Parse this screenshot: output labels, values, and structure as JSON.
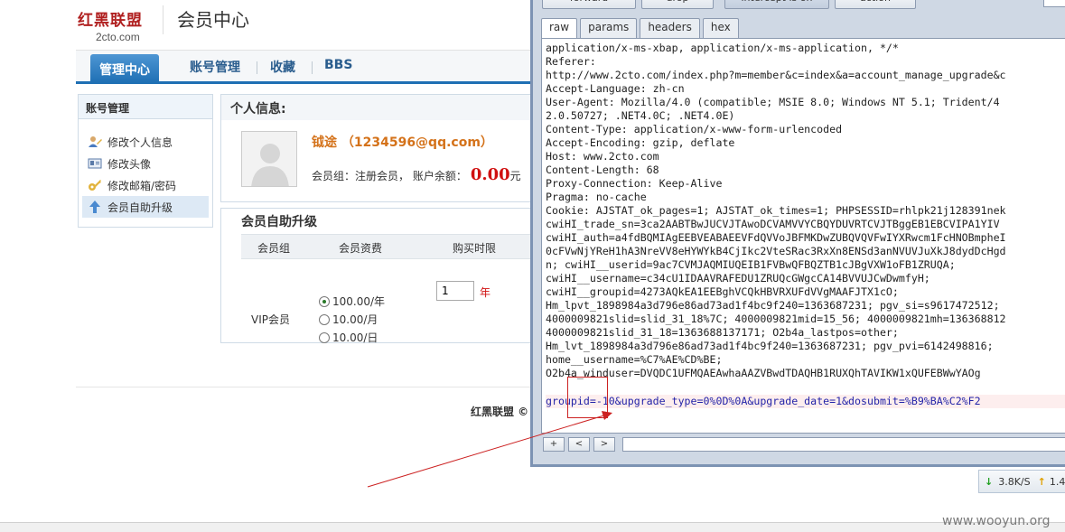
{
  "site": {
    "logo_mark": "红黑联盟",
    "logo_domain": "2cto.com",
    "page_title": "会员中心"
  },
  "nav": {
    "items": [
      {
        "label": "管理中心"
      },
      {
        "label": "账号管理"
      },
      {
        "label": "收藏"
      },
      {
        "label": "BBS"
      }
    ]
  },
  "sidebar": {
    "title": "账号管理",
    "items": [
      {
        "label": "修改个人信息",
        "icon": "user-edit-icon"
      },
      {
        "label": "修改头像",
        "icon": "avatar-card-icon"
      },
      {
        "label": "修改邮箱/密码",
        "icon": "key-icon"
      },
      {
        "label": "会员自助升级",
        "icon": "upgrade-arrow-icon"
      }
    ]
  },
  "profile": {
    "heading": "个人信息:",
    "name": "钺途 （1234596@qq.com）",
    "group_label": "会员组：注册会员， 账户余额：",
    "balance": "0.00",
    "currency": "元"
  },
  "upgrade": {
    "heading": "会员自助升级",
    "columns": [
      "会员组",
      "会员资费",
      "购买时限"
    ],
    "group": "VIP会员",
    "options": [
      {
        "label": "100.00/年",
        "checked": true
      },
      {
        "label": "10.00/月",
        "checked": false
      },
      {
        "label": "10.00/日",
        "checked": false
      }
    ],
    "years_value": "1",
    "years_unit": "年"
  },
  "footer": {
    "text": "红黑联盟 ©"
  },
  "tool": {
    "top_buttons": [
      "forward",
      "drop",
      "intercept is on",
      "action"
    ],
    "tabs": [
      "raw",
      "params",
      "headers",
      "hex"
    ],
    "active_tab": "raw",
    "raw_lines": [
      "application/x-ms-xbap, application/x-ms-application, */*",
      "Referer:",
      "http://www.2cto.com/index.php?m=member&c=index&a=account_manage_upgrade&c",
      "Accept-Language: zh-cn",
      "User-Agent: Mozilla/4.0 (compatible; MSIE 8.0; Windows NT 5.1; Trident/4",
      "2.0.50727; .NET4.0C; .NET4.0E)",
      "Content-Type: application/x-www-form-urlencoded",
      "Accept-Encoding: gzip, deflate",
      "Host: www.2cto.com",
      "Content-Length: 68",
      "Proxy-Connection: Keep-Alive",
      "Pragma: no-cache",
      "Cookie: AJSTAT_ok_pages=1; AJSTAT_ok_times=1; PHPSESSID=rhlpk21j128391nek",
      "cwiHI_trade_sn=3ca2AABTBwJUCVJTAwoDCVAMVVYCBQYDUVRTCVJTBggEB1EBCVIPA1YIV",
      "cwiHI_auth=a4fdBQMIAgEEBVEABAEEVFdQVVoJBFMKDwZUBQVQVFwIYXRwcm1FcHNOBmpheI",
      "0cFVwNjYReH1hA3NreVV8eHYWYkB4CjIkc2VteSRac3RxXn8ENSd3anNVUVJuXkJ8dydDcHgd",
      "n; cwiHI__userid=9ac7CVMJAQMIUQEIB1FVBwQFBQZTB1cJBgVXW1oFB1ZRUQA;",
      "cwiHI__username=c34cU1IDAAVRAFEDU1ZRUQcGWgcCA14BVVUJCwDwmfyH;",
      "cwiHI__groupid=4273AQkEA1EEBghVCQkHBVRXUFdVVgMAAFJTX1cO;",
      "Hm_lpvt_1898984a3d796e86ad73ad1f4bc9f240=1363687231; pgv_si=s9617472512;",
      "4000009821slid=slid_31_18%7C; 4000009821mid=15_56; 4000009821mh=136368812",
      "4000009821slid_31_18=1363688137171; O2b4a_lastpos=other;",
      "Hm_lvt_1898984a3d796e86ad73ad1f4bc9f240=1363687231; pgv_pvi=6142498816;",
      "home__username=%C7%AE%CD%BE;",
      "O2b4a_winduser=DVQDC1UFMQAEAwhaAAZVBwdTDAQHB1RUXQhTAVIKW1xQUFEBWwYAOg"
    ],
    "body_line": "groupid=-10&upgrade_type=0%0D%0A&upgrade_date=1&dosubmit=%B9%BA%C2%F2",
    "nav_buttons": [
      "+",
      "<",
      ">"
    ]
  },
  "status": {
    "download_speed": "3.8K/S",
    "upload_speed": "1.4"
  },
  "watermark": "www.wooyun.org",
  "colors": {
    "nav_accent": "#1e6fb4",
    "balance_red": "#d01010",
    "name_orange": "#d4721a",
    "annotation_red": "#cc2222"
  }
}
